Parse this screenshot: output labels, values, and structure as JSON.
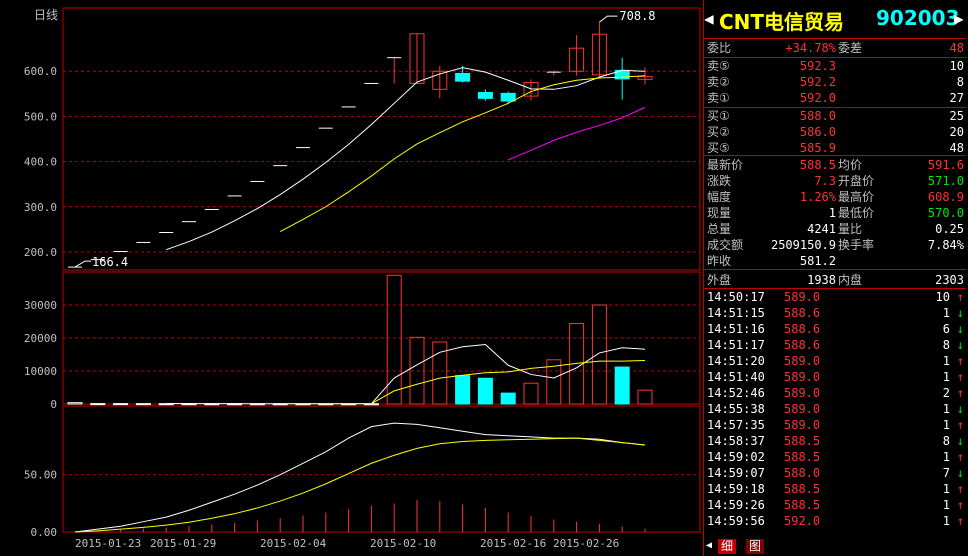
{
  "chart_data": [
    {
      "type": "candlestick",
      "title": "日线",
      "x_tick_labels": [
        "2015-01-23",
        "2015-01-29",
        "2015-02-04",
        "2015-02-10",
        "2015-02-16",
        "2015-02-26"
      ],
      "y_ticks": [
        200.0,
        300.0,
        400.0,
        500.0,
        600.0
      ],
      "ylim": [
        160,
        740
      ],
      "max_label": "708.8",
      "min_label": "166.4",
      "candles": [
        {
          "o": 166.4,
          "h": 166.4,
          "l": 166.4,
          "c": 166.4
        },
        {
          "o": 183,
          "h": 183,
          "l": 183,
          "c": 183
        },
        {
          "o": 201,
          "h": 201,
          "l": 201,
          "c": 201
        },
        {
          "o": 221,
          "h": 221,
          "l": 221,
          "c": 221
        },
        {
          "o": 243,
          "h": 243,
          "l": 243,
          "c": 243
        },
        {
          "o": 267,
          "h": 267,
          "l": 267,
          "c": 267
        },
        {
          "o": 294,
          "h": 294,
          "l": 294,
          "c": 294
        },
        {
          "o": 324,
          "h": 324,
          "l": 324,
          "c": 324
        },
        {
          "o": 356,
          "h": 356,
          "l": 356,
          "c": 356
        },
        {
          "o": 391,
          "h": 391,
          "l": 391,
          "c": 391
        },
        {
          "o": 431,
          "h": 431,
          "l": 431,
          "c": 431
        },
        {
          "o": 474,
          "h": 474,
          "l": 474,
          "c": 474
        },
        {
          "o": 521,
          "h": 521,
          "l": 521,
          "c": 521
        },
        {
          "o": 573,
          "h": 573,
          "l": 573,
          "c": 573
        },
        {
          "o": 630,
          "h": 630,
          "l": 573,
          "c": 630
        },
        {
          "o": 573,
          "h": 683,
          "l": 573,
          "c": 683
        },
        {
          "o": 560,
          "h": 612,
          "l": 540,
          "c": 600
        },
        {
          "o": 595,
          "h": 612,
          "l": 575,
          "c": 578
        },
        {
          "o": 553,
          "h": 560,
          "l": 535,
          "c": 540
        },
        {
          "o": 551,
          "h": 555,
          "l": 527,
          "c": 534
        },
        {
          "o": 545,
          "h": 582,
          "l": 535,
          "c": 575
        },
        {
          "o": 598,
          "h": 602,
          "l": 590,
          "c": 598
        },
        {
          "o": 600,
          "h": 680,
          "l": 590,
          "c": 651
        },
        {
          "o": 592,
          "h": 708.8,
          "l": 585,
          "c": 682
        },
        {
          "o": 602,
          "h": 630,
          "l": 537,
          "c": 583
        },
        {
          "o": 582,
          "h": 608.9,
          "l": 570,
          "c": 588.5
        }
      ],
      "ma5": [
        null,
        null,
        null,
        null,
        205,
        223,
        244,
        269,
        296,
        327,
        361,
        398,
        438,
        482,
        529,
        576,
        594,
        608,
        598,
        580,
        561,
        560,
        568,
        587,
        602,
        600
      ],
      "ma10": [
        null,
        null,
        null,
        null,
        null,
        null,
        null,
        null,
        null,
        245,
        272,
        300,
        333,
        368,
        406,
        439,
        464,
        488,
        508,
        529,
        555,
        570,
        580,
        585,
        587,
        590
      ],
      "ma20": [
        null,
        null,
        null,
        null,
        null,
        null,
        null,
        null,
        null,
        null,
        null,
        null,
        null,
        null,
        null,
        null,
        null,
        null,
        null,
        404,
        425,
        447,
        465,
        480,
        497,
        520
      ]
    },
    {
      "type": "bar",
      "title": "volume",
      "y_ticks": [
        0,
        10000,
        20000,
        30000
      ],
      "ylim": [
        0,
        40000
      ],
      "values": [
        400,
        120,
        120,
        110,
        100,
        100,
        90,
        90,
        90,
        80,
        80,
        80,
        80,
        80,
        39000,
        20200,
        18800,
        8600,
        7800,
        3300,
        6300,
        13400,
        24400,
        30000,
        11200,
        4200
      ],
      "ma5": [
        null,
        null,
        null,
        null,
        170,
        110,
        105,
        98,
        94,
        90,
        86,
        84,
        82,
        80,
        7870,
        11890,
        15660,
        17340,
        18040,
        11740,
        8960,
        7880,
        10960,
        15480,
        17060,
        16600
      ],
      "ma10": [
        null,
        null,
        null,
        null,
        null,
        null,
        null,
        null,
        null,
        130,
        108,
        103,
        98,
        95,
        3970,
        5980,
        7850,
        8710,
        9480,
        9740,
        10780,
        11440,
        12300,
        13000,
        13000,
        13200
      ]
    },
    {
      "type": "bar",
      "title": "indicator",
      "y_ticks": [
        0.0,
        50.0
      ],
      "ylim": [
        0,
        110
      ],
      "values": [
        0.5,
        1.2,
        2.0,
        3,
        4,
        5,
        6.5,
        8,
        10,
        12,
        14.5,
        17,
        20,
        23,
        25,
        28,
        27,
        24,
        21,
        17,
        14,
        11,
        9,
        7,
        5,
        3
      ],
      "line1": [
        0,
        2.5,
        5,
        9,
        13,
        19,
        26,
        33,
        41,
        50,
        60,
        70,
        82,
        92,
        95,
        94,
        91,
        88,
        85,
        84,
        83,
        82,
        82,
        81,
        78,
        76
      ],
      "line2": [
        0,
        1,
        2.5,
        4,
        6,
        8.5,
        12,
        16,
        21,
        27,
        34,
        42,
        51,
        60,
        67,
        73,
        77,
        79,
        80,
        80.5,
        81,
        81.5,
        82,
        80,
        78,
        76
      ]
    }
  ],
  "panel": {
    "name": "CNT电信贸易",
    "code": "902003",
    "webi_label": "委比",
    "webi_value": "+34.78%",
    "weicha_label": "委差",
    "weicha_value": "48",
    "asks": [
      {
        "label": "卖⑤",
        "price": "592.3",
        "vol": "10"
      },
      {
        "label": "卖②",
        "price": "592.2",
        "vol": "8"
      },
      {
        "label": "卖①",
        "price": "592.0",
        "vol": "27"
      }
    ],
    "bids": [
      {
        "label": "买①",
        "price": "588.0",
        "vol": "25"
      },
      {
        "label": "买②",
        "price": "586.0",
        "vol": "20"
      },
      {
        "label": "买⑤",
        "price": "585.9",
        "vol": "48"
      }
    ],
    "stats": [
      {
        "l1": "最新价",
        "v1": "588.5",
        "c1": "r",
        "l2": "均价",
        "v2": "591.6",
        "c2": "r"
      },
      {
        "l1": "涨跌",
        "v1": "7.3",
        "c1": "r",
        "l2": "开盘价",
        "v2": "571.0",
        "c2": "g"
      },
      {
        "l1": "幅度",
        "v1": "1.26%",
        "c1": "r",
        "l2": "最高价",
        "v2": "608.9",
        "c2": "r"
      },
      {
        "l1": "现量",
        "v1": "1",
        "c1": "w",
        "l2": "最低价",
        "v2": "570.0",
        "c2": "g"
      },
      {
        "l1": "总量",
        "v1": "4241",
        "c1": "w",
        "l2": "量比",
        "v2": "0.25",
        "c2": "w"
      },
      {
        "l1": "成交额",
        "v1": "2509150.9",
        "c1": "w",
        "l2": "换手率",
        "v2": "7.84%",
        "c2": "w"
      },
      {
        "l1": "昨收",
        "v1": "581.2",
        "c1": "w",
        "l2": "",
        "v2": "",
        "c2": "w"
      }
    ],
    "waipan_label": "外盘",
    "waipan_value": "1938",
    "neipan_label": "内盘",
    "neipan_value": "2303",
    "ticks": [
      {
        "t": "14:50:17",
        "p": "589.0",
        "pc": "r",
        "v": "10",
        "dir": "up"
      },
      {
        "t": "14:51:15",
        "p": "588.6",
        "pc": "r",
        "v": "1",
        "dir": "dn"
      },
      {
        "t": "14:51:16",
        "p": "588.6",
        "pc": "r",
        "v": "6",
        "dir": "dn"
      },
      {
        "t": "14:51:17",
        "p": "588.6",
        "pc": "r",
        "v": "8",
        "dir": "dn"
      },
      {
        "t": "14:51:20",
        "p": "589.0",
        "pc": "r",
        "v": "1",
        "dir": "up"
      },
      {
        "t": "14:51:40",
        "p": "589.0",
        "pc": "r",
        "v": "1",
        "dir": "up"
      },
      {
        "t": "14:52:46",
        "p": "589.0",
        "pc": "r",
        "v": "2",
        "dir": "up"
      },
      {
        "t": "14:55:38",
        "p": "589.0",
        "pc": "r",
        "v": "1",
        "dir": "dn"
      },
      {
        "t": "14:57:35",
        "p": "589.0",
        "pc": "r",
        "v": "1",
        "dir": "up"
      },
      {
        "t": "14:58:37",
        "p": "588.5",
        "pc": "r",
        "v": "8",
        "dir": "dn"
      },
      {
        "t": "14:59:02",
        "p": "588.5",
        "pc": "r",
        "v": "1",
        "dir": "up"
      },
      {
        "t": "14:59:07",
        "p": "588.0",
        "pc": "r",
        "v": "7",
        "dir": "dn"
      },
      {
        "t": "14:59:18",
        "p": "588.5",
        "pc": "r",
        "v": "1",
        "dir": "up"
      },
      {
        "t": "14:59:26",
        "p": "588.5",
        "pc": "r",
        "v": "1",
        "dir": "up"
      },
      {
        "t": "14:59:56",
        "p": "592.0",
        "pc": "r",
        "v": "1",
        "dir": "up"
      }
    ],
    "tab1": "细",
    "tab2": "图",
    "colors": {
      "up": "#ff3232",
      "down": "#00ffff",
      "ma5": "#ffffff",
      "ma10": "#ffff00",
      "ma20": "#ff00ff",
      "grid": "#c00000"
    }
  }
}
